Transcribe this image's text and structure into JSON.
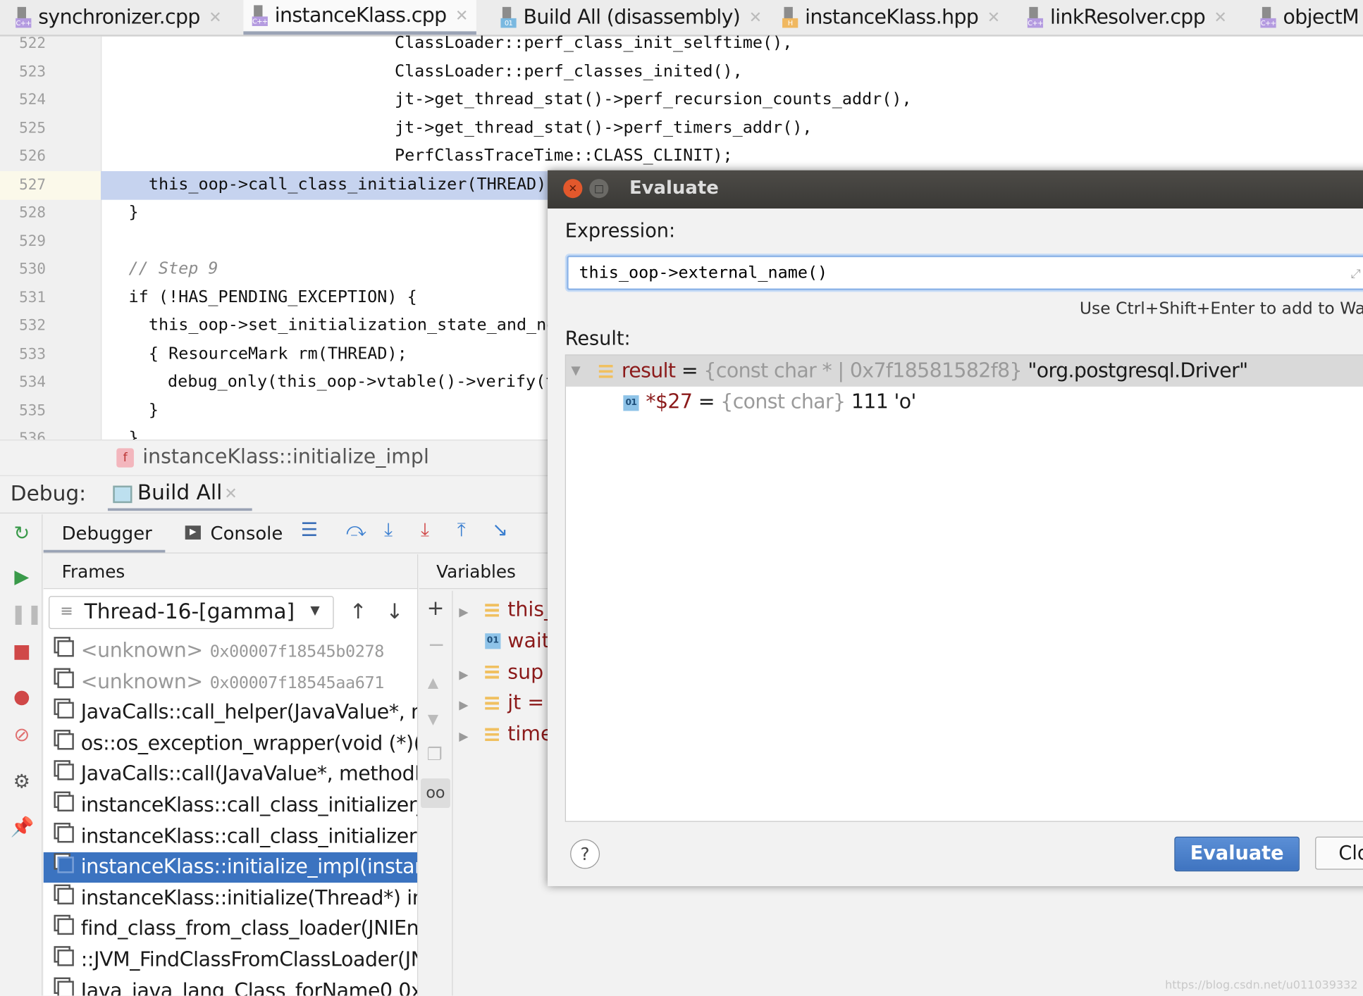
{
  "tabs": [
    {
      "label": "synchronizer.cpp",
      "type": "C++",
      "color": "#b49be0",
      "active": false
    },
    {
      "label": "instanceKlass.cpp",
      "type": "C++",
      "color": "#b49be0",
      "active": true
    },
    {
      "label": "Build All (disassembly)",
      "type": "01",
      "color": "#7ab8e0",
      "active": false
    },
    {
      "label": "instanceKlass.hpp",
      "type": "H",
      "color": "#f0b860",
      "active": false
    },
    {
      "label": "linkResolver.cpp",
      "type": "C++",
      "color": "#b49be0",
      "active": false
    },
    {
      "label": "objectM",
      "type": "C++",
      "color": "#b49be0",
      "active": false
    }
  ],
  "editor": {
    "lines": [
      {
        "n": "522",
        "code": "ClassLoader::perf_class_init_selftime(),",
        "indent": 3
      },
      {
        "n": "523",
        "code": "ClassLoader::perf_classes_inited(),",
        "indent": 3
      },
      {
        "n": "524",
        "code": "jt->get_thread_stat()->perf_recursion_counts_addr(),",
        "indent": 3
      },
      {
        "n": "525",
        "code": "jt->get_thread_stat()->perf_timers_addr(),",
        "indent": 3
      },
      {
        "n": "526",
        "code": "PerfClassTraceTime::CLASS_CLINIT);",
        "indent": 3
      },
      {
        "n": "527",
        "code": "this_oop->call_class_initializer(THREAD);",
        "indent": 1
      },
      {
        "n": "528",
        "code": "}",
        "indent": 0
      },
      {
        "n": "529",
        "code": "",
        "indent": 0
      },
      {
        "n": "530",
        "code": "// Step 9",
        "indent": 0,
        "comment": true
      },
      {
        "n": "531",
        "code": "if (!HAS_PENDING_EXCEPTION) {",
        "indent": 0
      },
      {
        "n": "532",
        "code": "this_oop->set_initialization_state_and_notify",
        "indent": 1
      },
      {
        "n": "533",
        "code": "{ ResourceMark rm(THREAD);",
        "indent": 1
      },
      {
        "n": "534",
        "code": "debug_only(this_oop->vtable()->verify(tty, true));",
        "indent": 2
      },
      {
        "n": "535",
        "code": "}",
        "indent": 1
      },
      {
        "n": "536",
        "code": "}",
        "indent": 0
      }
    ],
    "current_line": "527"
  },
  "breadcrumb": {
    "icon": "function-icon",
    "label": "instanceKlass::initialize_impl"
  },
  "debug": {
    "label": "Debug:",
    "session_tab": "Build All",
    "tabs": [
      "Debugger",
      "Console"
    ],
    "frames_header": "Frames",
    "variables_header": "Variables",
    "thread": "Thread-16-[gamma]",
    "frames": [
      {
        "name": "<unknown>",
        "addr": "0x00007f18545b0278",
        "unknown": true
      },
      {
        "name": "<unknown>",
        "addr": "0x00007f18545aa671",
        "unknown": true
      },
      {
        "name": "JavaCalls::call_helper(JavaValue*, methodHandle*, JavaCallArguments*, Thread*)"
      },
      {
        "name": "os::os_exception_wrapper(void (*)(JavaValue*, methodHandle*, JavaCallArguments*, Thread*)"
      },
      {
        "name": "JavaCalls::call(JavaValue*, methodHandle, JavaCallArguments*, Thread*)"
      },
      {
        "name": "instanceKlass::call_class_initializer_impl(instanceKlassHandle, Thread*)"
      },
      {
        "name": "instanceKlass::call_class_initializer(Thread*)"
      },
      {
        "name": "instanceKlass::initialize_impl(instanceKlassHandle, Thread*)",
        "selected": true
      },
      {
        "name": "instanceKlass::initialize(Thread*) in"
      },
      {
        "name": "find_class_from_class_loader(JNIEnv*, Symbol*, unsigned char, Handle, Handle, unsigned char, Thread*)"
      },
      {
        "name": "::JVM_FindClassFromClassLoader(JNIEnv*, const char*, jboolean, jobject, jboolean)"
      },
      {
        "name": "Java_java_lang_Class_forName0 0x"
      }
    ],
    "variables": [
      {
        "name": "this_",
        "expandable": true,
        "icon": "struct-icon"
      },
      {
        "name": "wait",
        "expandable": false,
        "icon": "primitive-icon"
      },
      {
        "name": "sup",
        "expandable": true,
        "icon": "struct-icon"
      },
      {
        "name": "jt = {",
        "expandable": true,
        "icon": "struct-icon"
      },
      {
        "name": "time",
        "expandable": true,
        "icon": "struct-icon"
      }
    ]
  },
  "dialog": {
    "title": "Evaluate",
    "expression_label": "Expression:",
    "expression": "this_oop->external_name()",
    "hint": "Use Ctrl+Shift+Enter to add to Watches",
    "result_label": "Result:",
    "result": {
      "name": "result",
      "type": "{const char * | 0x7f18581582f8}",
      "value": "\"org.postgresql.Driver\"",
      "child": {
        "name": "*$27",
        "type": "{const char}",
        "value": "111 'o'"
      }
    },
    "help": "?",
    "evaluate_button": "Evaluate",
    "close_button": "Close"
  },
  "watermark": "https://blog.csdn.net/u011039332",
  "colors": {
    "selection": "#3b73c0",
    "current_line": "#c6d3ef",
    "var_name": "#8b1a1a",
    "dialog_title": "#3f3e3b"
  }
}
